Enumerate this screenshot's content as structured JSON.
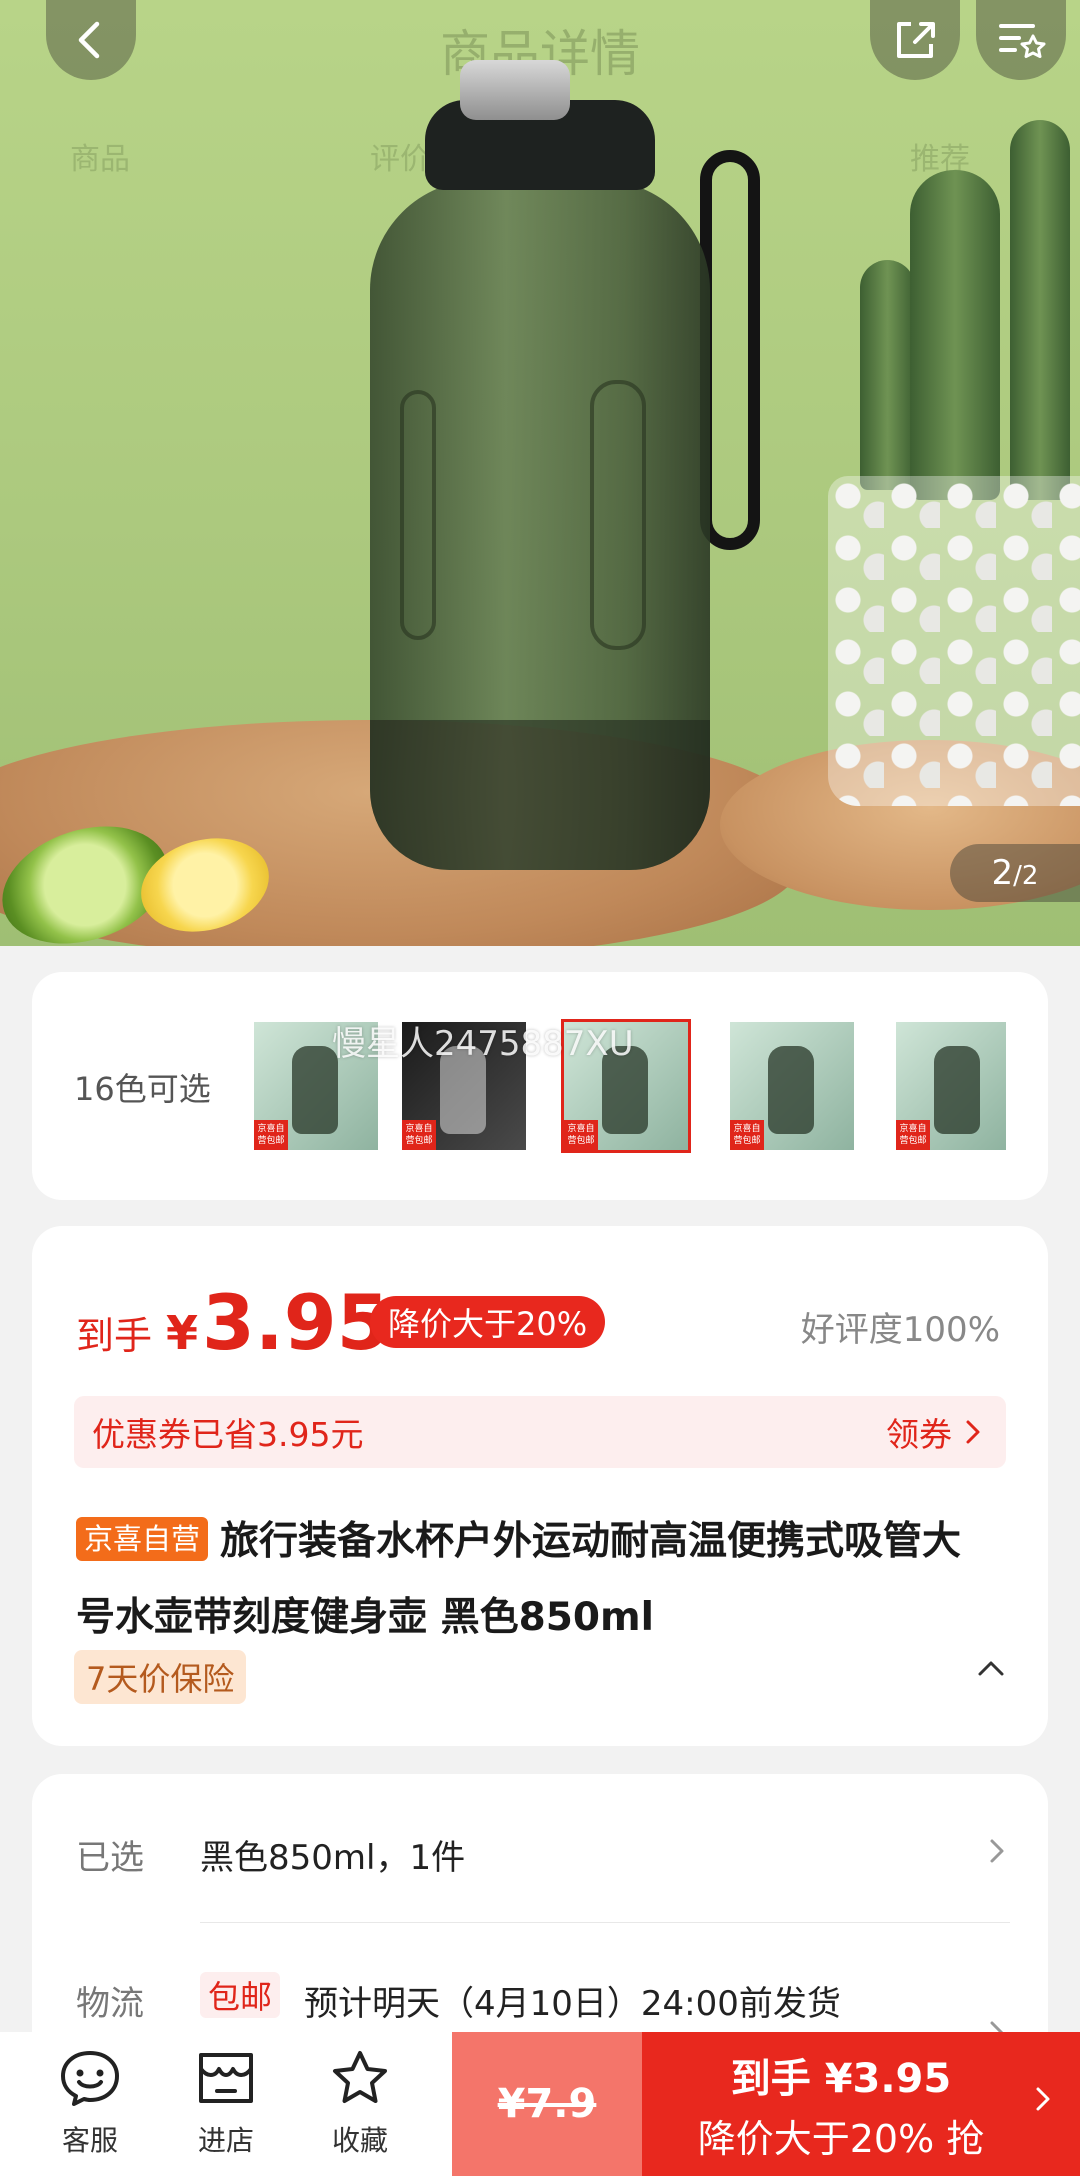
{
  "hero": {
    "ghost_title": "商品详情",
    "ghost_tabs": [
      "商品",
      "评价",
      "推荐"
    ],
    "page_current": "2",
    "page_total": "/2"
  },
  "colors": {
    "label": "16色可选",
    "watermark": "慢星人2475887XU",
    "thumb_tag": "京喜自营包邮",
    "selected_index": 2
  },
  "price": {
    "prefix": "到手",
    "currency": "¥",
    "value": "3.95",
    "discount_badge": "降价大于20%",
    "rating": "好评度100%",
    "coupon_text": "优惠券已省3.95元",
    "coupon_action": "领券"
  },
  "product": {
    "store_tag": "京喜自营",
    "title": "旅行装备水杯户外运动耐高温便携式吸管大号水壶带刻度健身壶 黑色850ml",
    "protect_tag": "7天价保险"
  },
  "info": {
    "selected_label": "已选",
    "selected_value": "黑色850ml，1件",
    "logistics_label": "物流",
    "free_shipping_tag": "包邮",
    "logistics_value": "预计明天（4月10日）24:00前发货"
  },
  "bottom": {
    "service_label": "客服",
    "store_label": "进店",
    "favorite_label": "收藏",
    "original_price": "¥7.9",
    "buy_line1": "到手 ¥3.95",
    "buy_line2": "降价大于20% 抢"
  },
  "colors_theme": {
    "accent_red": "#e0251a",
    "orange_tag": "#f36c1a"
  }
}
